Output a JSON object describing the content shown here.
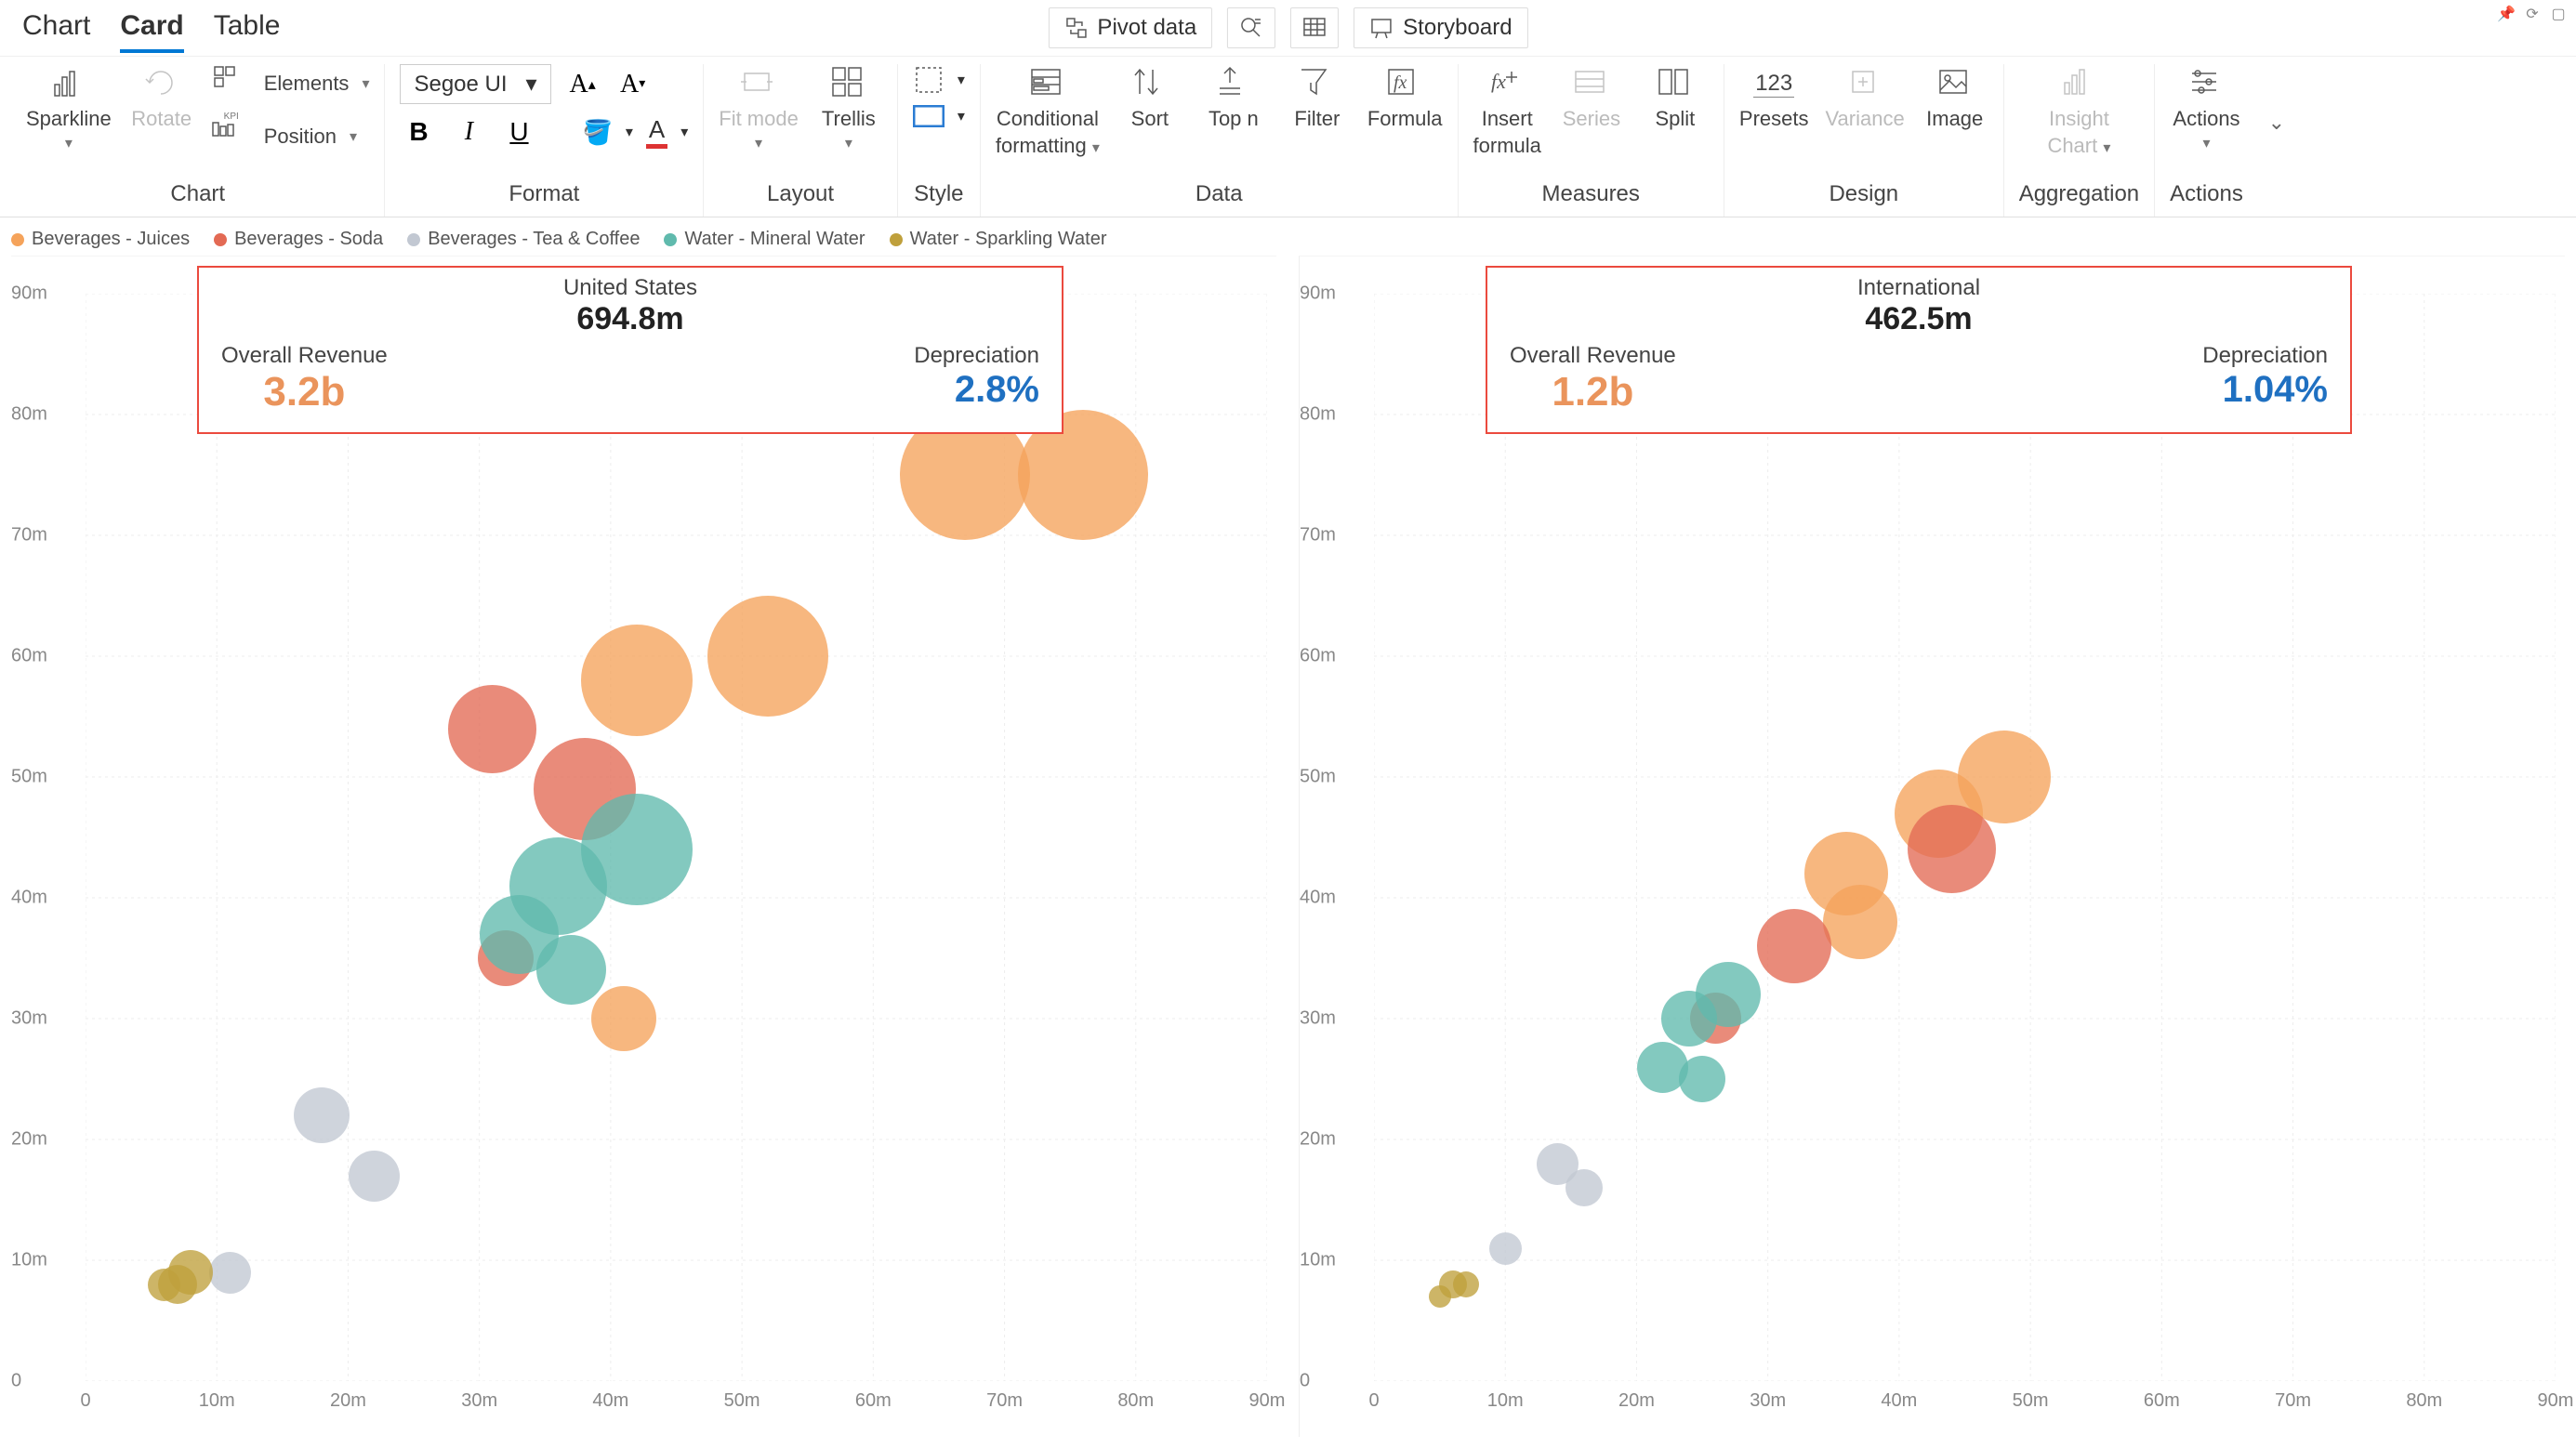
{
  "tabs": {
    "chart": "Chart",
    "card": "Card",
    "table": "Table",
    "active": "card"
  },
  "top_toolbar": {
    "pivot": "Pivot  data",
    "storyboard": "Storyboard"
  },
  "ribbon": {
    "chart_group": "Chart",
    "sparkline": "Sparkline",
    "rotate": "Rotate",
    "elements": "Elements",
    "position": "Position",
    "kpi": "KPI",
    "format_group": "Format",
    "font_family": "Segoe UI",
    "layout_group": "Layout",
    "fit_mode": "Fit mode",
    "trellis": "Trellis",
    "style_group": "Style",
    "data_group": "Data",
    "conditional_formatting": "Conditional",
    "conditional_formatting2": "formatting",
    "sort": "Sort",
    "top_n": "Top n",
    "filter": "Filter",
    "formula": "Formula",
    "measures_group": "Measures",
    "insert_formula": "Insert",
    "insert_formula2": "formula",
    "series": "Series",
    "split": "Split",
    "design_group": "Design",
    "presets": "Presets",
    "variance": "Variance",
    "image": "Image",
    "presets_num": "123",
    "aggregation_group": "Aggregation",
    "insight_chart": "Insight",
    "insight_chart2": "Chart",
    "actions_group": "Actions",
    "actions": "Actions"
  },
  "legend": [
    {
      "label": "Beverages - Juices",
      "color": "#f5a35b"
    },
    {
      "label": "Beverages - Soda",
      "color": "#e36a54"
    },
    {
      "label": "Beverages - Tea & Coffee",
      "color": "#c2c8d2"
    },
    {
      "label": "Water - Mineral Water",
      "color": "#60baad"
    },
    {
      "label": "Water - Sparkling Water",
      "color": "#bfa03c"
    }
  ],
  "axis": {
    "y_ticks": [
      "90m",
      "80m",
      "70m",
      "60m",
      "50m",
      "40m",
      "30m",
      "20m",
      "10m",
      "0"
    ],
    "x_ticks": [
      "0",
      "10m",
      "20m",
      "30m",
      "40m",
      "50m",
      "60m",
      "70m",
      "80m",
      "90m"
    ]
  },
  "cards": [
    {
      "region": "United States",
      "amount": "694.8m",
      "overall_label": "Overall Revenue",
      "overall_val": "3.2b",
      "dep_label": "Depreciation",
      "dep_val": "2.8%"
    },
    {
      "region": "International",
      "amount": "462.5m",
      "overall_label": "Overall Revenue",
      "overall_val": "1.2b",
      "dep_label": "Depreciation",
      "dep_val": "1.04%"
    }
  ],
  "chart_data": [
    {
      "type": "scatter",
      "title": "United States",
      "xlabel": "",
      "ylabel": "",
      "xlim": [
        0,
        90
      ],
      "ylim": [
        0,
        90
      ],
      "unit": "m",
      "series": [
        {
          "name": "Beverages - Juices",
          "color": "#f5a35b",
          "points": [
            {
              "x": 67,
              "y": 75,
              "size": 140
            },
            {
              "x": 76,
              "y": 75,
              "size": 140
            },
            {
              "x": 52,
              "y": 60,
              "size": 130
            },
            {
              "x": 42,
              "y": 58,
              "size": 120
            },
            {
              "x": 41,
              "y": 30,
              "size": 70
            }
          ]
        },
        {
          "name": "Beverages - Soda",
          "color": "#e36a54",
          "points": [
            {
              "x": 38,
              "y": 49,
              "size": 110
            },
            {
              "x": 31,
              "y": 54,
              "size": 95
            },
            {
              "x": 32,
              "y": 35,
              "size": 60
            }
          ]
        },
        {
          "name": "Water - Mineral Water",
          "color": "#60baad",
          "points": [
            {
              "x": 42,
              "y": 44,
              "size": 120
            },
            {
              "x": 36,
              "y": 41,
              "size": 105
            },
            {
              "x": 33,
              "y": 37,
              "size": 85
            },
            {
              "x": 37,
              "y": 34,
              "size": 75
            }
          ]
        },
        {
          "name": "Beverages - Tea & Coffee",
          "color": "#c2c8d2",
          "points": [
            {
              "x": 18,
              "y": 22,
              "size": 60
            },
            {
              "x": 22,
              "y": 17,
              "size": 55
            },
            {
              "x": 11,
              "y": 9,
              "size": 45
            }
          ]
        },
        {
          "name": "Water - Sparkling Water",
          "color": "#bfa03c",
          "points": [
            {
              "x": 7,
              "y": 8,
              "size": 42
            },
            {
              "x": 8,
              "y": 9,
              "size": 48
            },
            {
              "x": 6,
              "y": 8,
              "size": 35
            }
          ]
        }
      ]
    },
    {
      "type": "scatter",
      "title": "International",
      "xlabel": "",
      "ylabel": "",
      "xlim": [
        0,
        90
      ],
      "ylim": [
        0,
        90
      ],
      "unit": "m",
      "series": [
        {
          "name": "Beverages - Juices",
          "color": "#f5a35b",
          "points": [
            {
              "x": 48,
              "y": 50,
              "size": 100
            },
            {
              "x": 43,
              "y": 47,
              "size": 95
            },
            {
              "x": 36,
              "y": 42,
              "size": 90
            },
            {
              "x": 37,
              "y": 38,
              "size": 80
            }
          ]
        },
        {
          "name": "Beverages - Soda",
          "color": "#e36a54",
          "points": [
            {
              "x": 44,
              "y": 44,
              "size": 95
            },
            {
              "x": 32,
              "y": 36,
              "size": 80
            },
            {
              "x": 26,
              "y": 30,
              "size": 55
            }
          ]
        },
        {
          "name": "Water - Mineral Water",
          "color": "#60baad",
          "points": [
            {
              "x": 27,
              "y": 32,
              "size": 70
            },
            {
              "x": 24,
              "y": 30,
              "size": 60
            },
            {
              "x": 22,
              "y": 26,
              "size": 55
            },
            {
              "x": 25,
              "y": 25,
              "size": 50
            }
          ]
        },
        {
          "name": "Beverages - Tea & Coffee",
          "color": "#c2c8d2",
          "points": [
            {
              "x": 14,
              "y": 18,
              "size": 45
            },
            {
              "x": 16,
              "y": 16,
              "size": 40
            },
            {
              "x": 10,
              "y": 11,
              "size": 35
            }
          ]
        },
        {
          "name": "Water - Sparkling Water",
          "color": "#bfa03c",
          "points": [
            {
              "x": 6,
              "y": 8,
              "size": 30
            },
            {
              "x": 7,
              "y": 8,
              "size": 28
            },
            {
              "x": 5,
              "y": 7,
              "size": 24
            }
          ]
        }
      ]
    }
  ]
}
